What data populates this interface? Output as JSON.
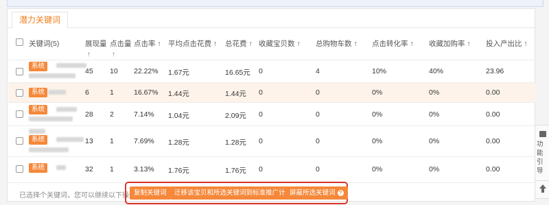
{
  "tab_label": "潜力关键词",
  "columns": {
    "keyword": "关键词(5)",
    "impressions": "展现量",
    "clicks": "点击量",
    "ctr": "点击率 ↑",
    "avg_cpc": "平均点击花费 ↑",
    "total_cost": "总花费 ↑",
    "fav_items": "收藏宝贝数 ↑",
    "cart_total": "总购物车数 ↑",
    "conversion": "点击转化率 ↑",
    "fav_add_rate": "收藏加购率 ↑",
    "roi": "投入产出比 ↑",
    "sort_arrow": "↑"
  },
  "rows": [
    {
      "tag": "系统",
      "impressions": "45",
      "clicks": "10",
      "ctr": "22.22%",
      "avg_cpc": "1.67元",
      "total_cost": "16.65元",
      "fav_items": "0",
      "cart_total": "4",
      "conversion": "10%",
      "fav_add_rate": "40%",
      "roi": "23.96"
    },
    {
      "tag": "系统",
      "impressions": "6",
      "clicks": "1",
      "ctr": "16.67%",
      "avg_cpc": "1.44元",
      "total_cost": "1.44元",
      "fav_items": "0",
      "cart_total": "0",
      "conversion": "0%",
      "fav_add_rate": "0%",
      "roi": "0.00"
    },
    {
      "tag": "系统",
      "impressions": "28",
      "clicks": "2",
      "ctr": "7.14%",
      "avg_cpc": "1.04元",
      "total_cost": "2.09元",
      "fav_items": "0",
      "cart_total": "0",
      "conversion": "0%",
      "fav_add_rate": "0%",
      "roi": "0.00"
    },
    {
      "tag": "系统",
      "impressions": "13",
      "clicks": "1",
      "ctr": "7.69%",
      "avg_cpc": "1.28元",
      "total_cost": "1.28元",
      "fav_items": "0",
      "cart_total": "0",
      "conversion": "0%",
      "fav_add_rate": "0%",
      "roi": "0.00"
    },
    {
      "tag": "系统",
      "impressions": "32",
      "clicks": "1",
      "ctr": "3.13%",
      "avg_cpc": "1.76元",
      "total_cost": "1.76元",
      "fav_items": "0",
      "cart_total": "0",
      "conversion": "0%",
      "fav_add_rate": "0%",
      "roi": "0.00"
    }
  ],
  "footer": {
    "hint": "已选择个关键词，您可以继续以下操作：",
    "buttons": {
      "copy": "复制关键词",
      "migrate": "迁移该宝贝和所选关键词到标准推广计划",
      "block": "屏蔽所选关键词",
      "help_glyph": "?"
    }
  },
  "side": {
    "guide_label": "功能引导"
  },
  "colors": {
    "accent": "#f07e1b",
    "tag_bg": "#f5883a",
    "highlight_row": "#fdf3ea",
    "annotation_box": "#d9342b"
  }
}
